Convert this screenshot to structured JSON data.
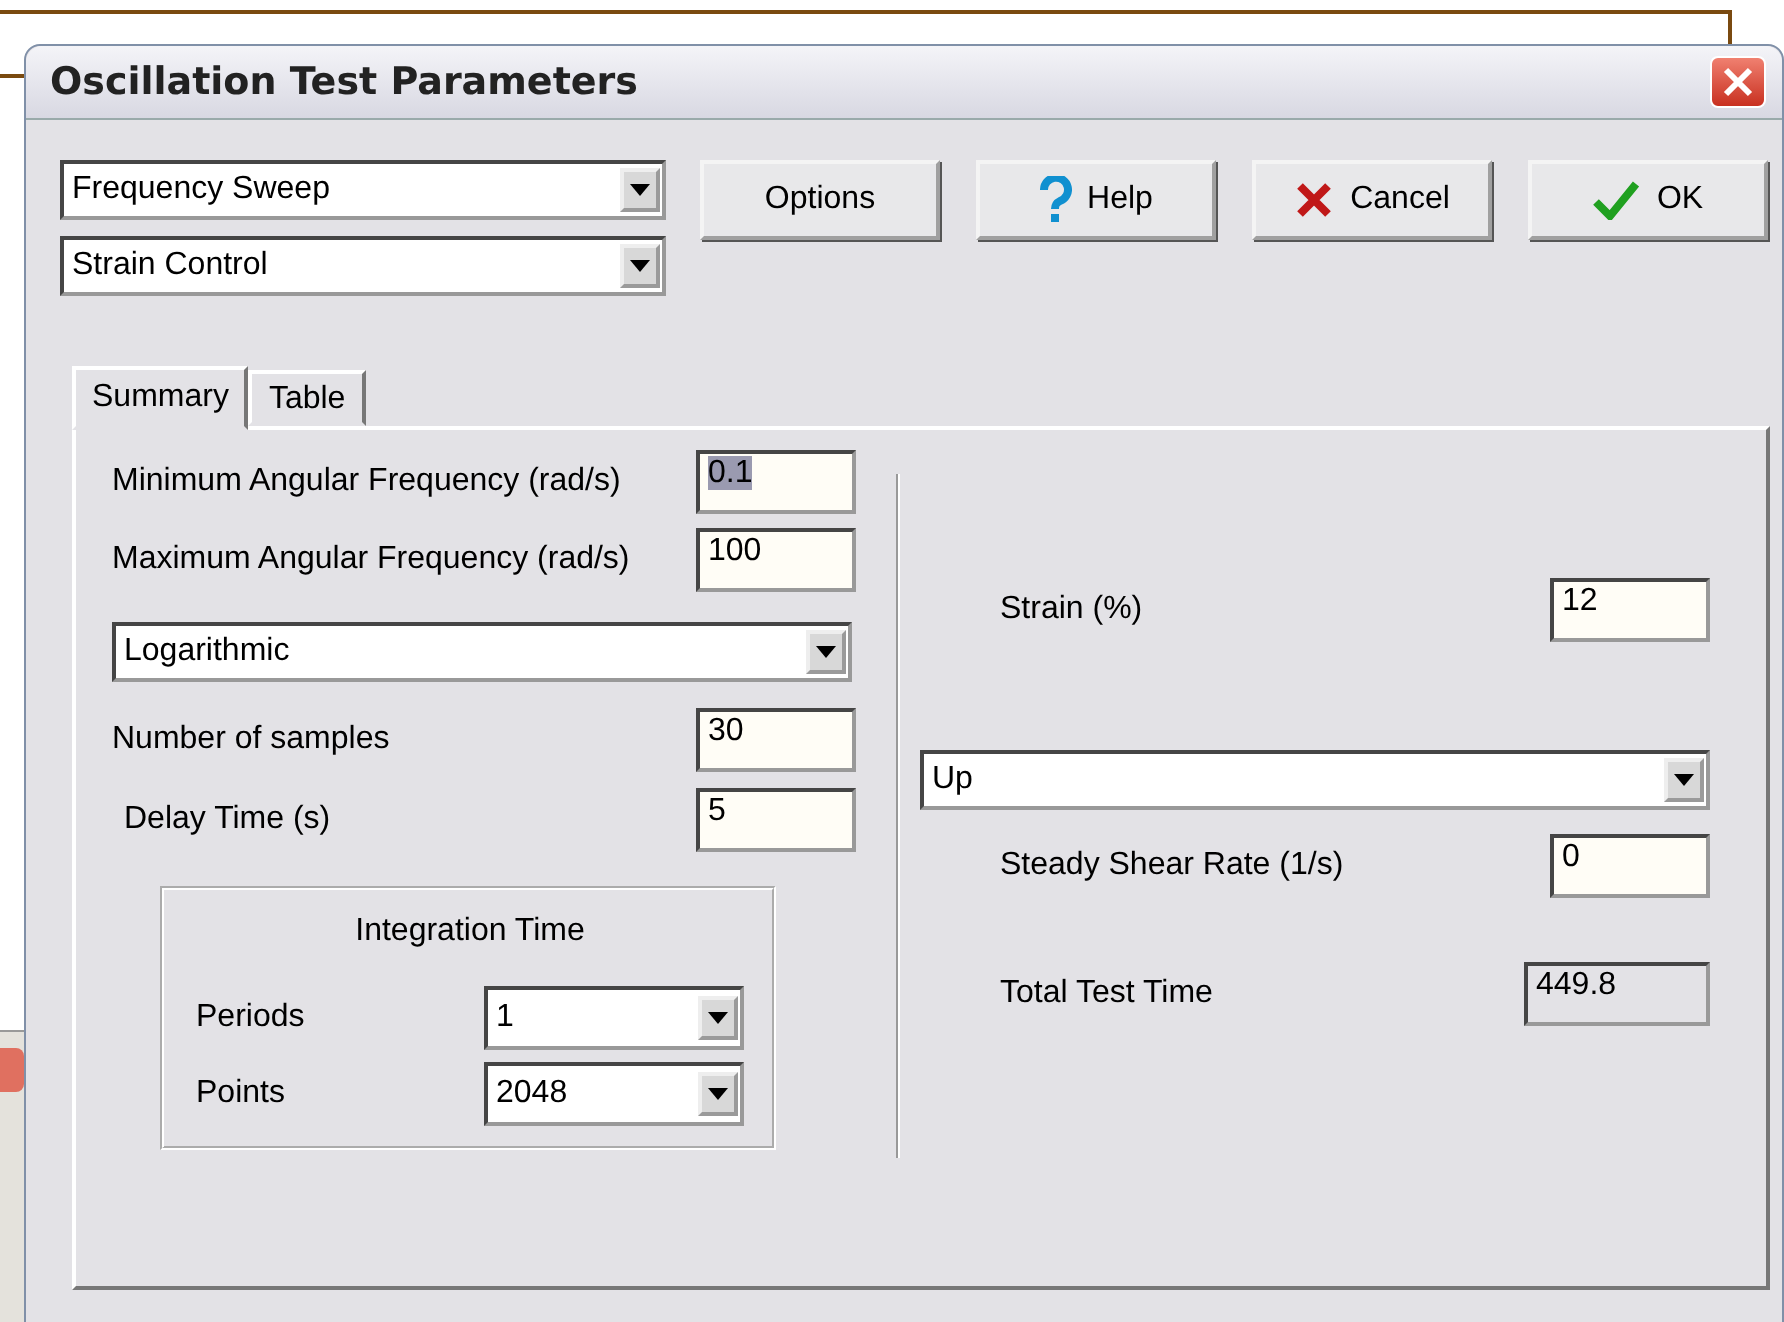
{
  "window": {
    "title": "Oscillation Test Parameters"
  },
  "mode_selects": [
    {
      "value": "Frequency Sweep"
    },
    {
      "value": "Strain Control"
    }
  ],
  "buttons": [
    {
      "label": "Options",
      "kind": "plain"
    },
    {
      "label": "Help",
      "kind": "help"
    },
    {
      "label": "Cancel",
      "kind": "cancel"
    },
    {
      "label": "OK",
      "kind": "ok"
    }
  ],
  "tabs": [
    {
      "label": "Summary",
      "selected": true
    },
    {
      "label": "Table",
      "selected": false
    }
  ],
  "left": [
    {
      "kind": "field",
      "label": "Minimum Angular Frequency (rad/s)",
      "value": "0.1",
      "text_selected": true
    },
    {
      "kind": "field",
      "label": "Maximum Angular Frequency (rad/s)",
      "value": "100",
      "text_selected": false
    },
    {
      "kind": "select",
      "value": "Logarithmic"
    },
    {
      "kind": "field",
      "label": "Number of samples",
      "value": "30",
      "text_selected": false
    },
    {
      "kind": "field",
      "label": "Delay Time (s)",
      "value": "5",
      "text_selected": false
    }
  ],
  "integration": {
    "title": "Integration Time",
    "rows": [
      {
        "label": "Periods",
        "value": "1"
      },
      {
        "label": "Points",
        "value": "2048"
      }
    ]
  },
  "right": [
    {
      "kind": "field",
      "label": "Strain (%)",
      "value": "12",
      "text_selected": false
    },
    {
      "kind": "select",
      "value": "Up"
    },
    {
      "kind": "field",
      "label": "Steady Shear Rate (1/s)",
      "value": "0",
      "text_selected": false
    },
    {
      "kind": "readout",
      "label": "Total Test Time",
      "value": "449.8"
    }
  ]
}
